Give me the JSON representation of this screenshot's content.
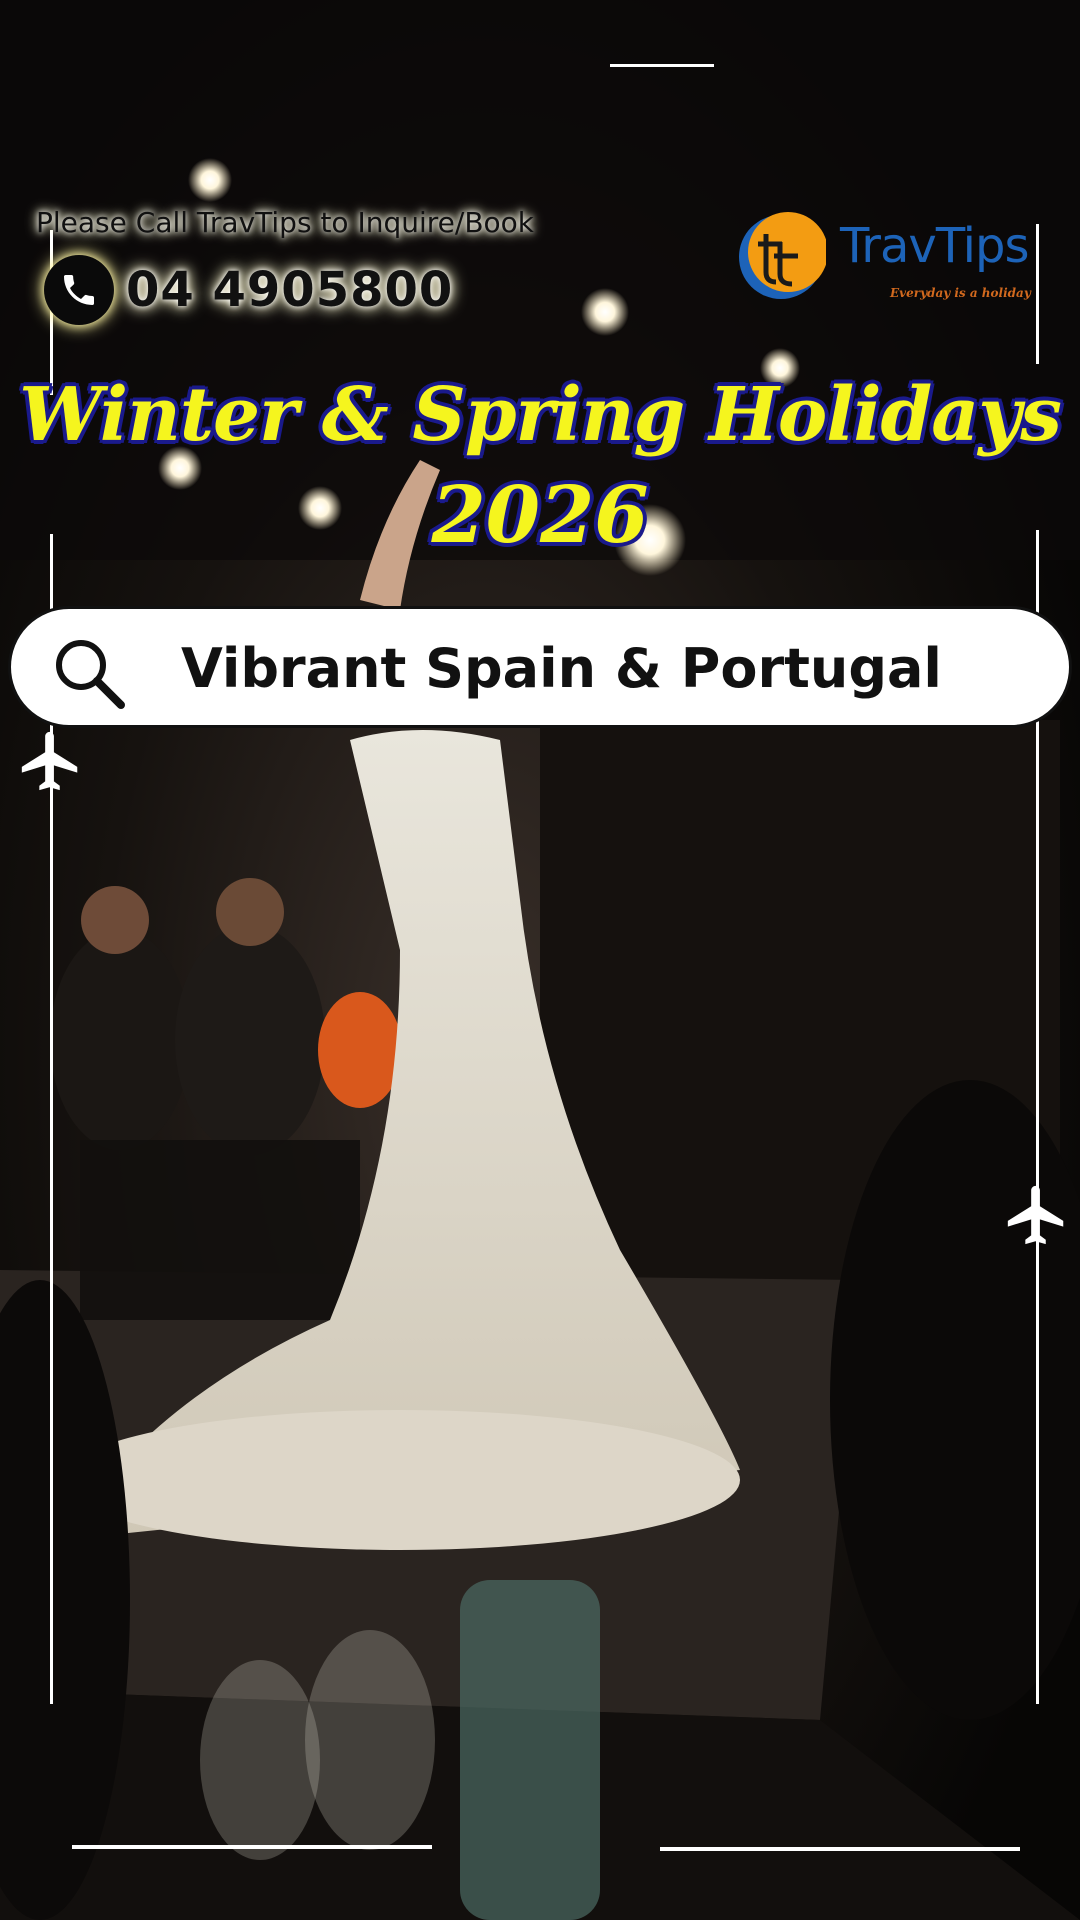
{
  "contact": {
    "call_label": "Please Call TravTips to Inquire/Book",
    "phone": "04 4905800",
    "phone_icon": "phone-icon"
  },
  "logo": {
    "name": "TravTips",
    "tagline": "Everyday is a holiday",
    "colors": {
      "primary": "#1d63b8",
      "accent": "#f39c12"
    }
  },
  "headline": {
    "line1": "Winter & Spring Holidays",
    "line2": "2026",
    "color": "#f5f51e",
    "outline": "#1a1a8c"
  },
  "search": {
    "icon": "search-icon",
    "text": "Vibrant Spain & Portugal"
  },
  "decorations": {
    "plane_icon": "airplane-icon"
  }
}
